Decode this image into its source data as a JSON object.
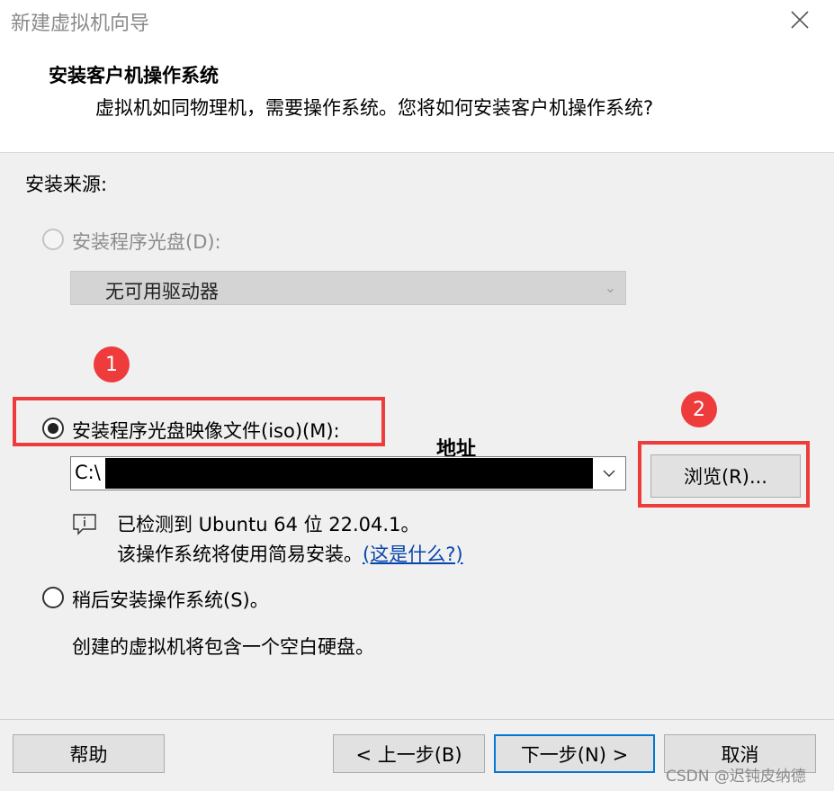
{
  "window": {
    "title": "新建虚拟机向导"
  },
  "header": {
    "title": "安装客户机操作系统",
    "subtitle": "虚拟机如同物理机，需要操作系统。您将如何安装客户机操作系统?"
  },
  "install_source": {
    "label": "安装来源:",
    "disc_option": {
      "label": "安装程序光盘(D):",
      "checked": false,
      "enabled": false
    },
    "disc_combo": {
      "value": "无可用驱动器"
    },
    "iso_option": {
      "label": "安装程序光盘映像文件(iso)(M):",
      "checked": true
    },
    "iso_path": {
      "value": "C:\\"
    },
    "address_annotation": "地址",
    "browse_button": "浏览(R)...",
    "detection": {
      "line1": "已检测到 Ubuntu 64 位 22.04.1。",
      "line2": "该操作系统将使用简易安装。",
      "link": "(这是什么?)"
    },
    "later_option": {
      "label": "稍后安装操作系统(S)。",
      "checked": false
    },
    "later_note": "创建的虚拟机将包含一个空白硬盘。"
  },
  "annotations": {
    "marker1": "1",
    "marker2": "2",
    "color": "#ee3b3b"
  },
  "footer": {
    "help": "帮助",
    "back": "< 上一步(B)",
    "next": "下一步(N) >",
    "cancel": "取消"
  },
  "watermark": "CSDN @迟钝皮纳德"
}
